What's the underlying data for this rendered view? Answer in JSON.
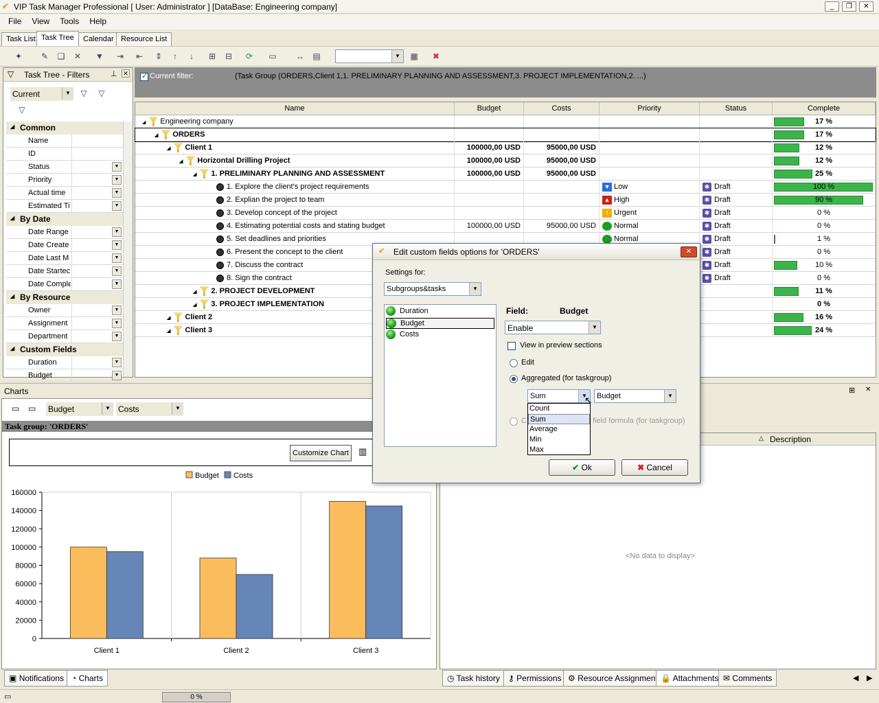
{
  "window": {
    "title": "VIP Task Manager Professional [ User: Administrator ] [DataBase: Engineering company]"
  },
  "menu": [
    "File",
    "View",
    "Tools",
    "Help"
  ],
  "tabs": [
    "Task List",
    "Task Tree",
    "Calendar",
    "Resource List"
  ],
  "filters_panel": {
    "title": "Task Tree - Filters",
    "current_value": "Current",
    "categories": [
      {
        "name": "Common",
        "items": [
          "Name",
          "ID",
          "Status",
          "Priority",
          "Actual time",
          "Estimated Ti"
        ]
      },
      {
        "name": "By Date",
        "items": [
          "Date Range",
          "Date Create",
          "Date Last M",
          "Date Startec",
          "Date Comple"
        ]
      },
      {
        "name": "By Resource",
        "items": [
          "Owner",
          "Assignment",
          "Department"
        ]
      },
      {
        "name": "Custom Fields",
        "items": [
          "Duration",
          "Budget"
        ]
      }
    ]
  },
  "filter_bar": {
    "label": "Current filter:",
    "text": "(Task Group  (ORDERS,Client 1,1. PRELIMINARY PLANNING AND ASSESSMENT,3. PROJECT IMPLEMENTATION,2. ...)"
  },
  "grid": {
    "columns": [
      "Name",
      "Budget",
      "Costs",
      "Priority",
      "Status",
      "Complete"
    ],
    "rows": [
      {
        "name": "Engineering company",
        "budget": "",
        "costs": "",
        "priority": "",
        "status": "",
        "complete": "17 %",
        "pct": 17,
        "bold": false
      },
      {
        "name": "ORDERS",
        "budget": "",
        "costs": "",
        "priority": "",
        "status": "",
        "complete": "17 %",
        "pct": 17,
        "bold": true
      },
      {
        "name": "Client 1",
        "budget": "100000,00 USD",
        "costs": "95000,00 USD",
        "priority": "",
        "status": "",
        "complete": "12 %",
        "pct": 12,
        "bold": true
      },
      {
        "name": "Horizontal Drilling Project",
        "budget": "100000,00 USD",
        "costs": "95000,00 USD",
        "priority": "",
        "status": "",
        "complete": "12 %",
        "pct": 12,
        "bold": true
      },
      {
        "name": "1. PRELIMINARY PLANNING AND ASSESSMENT",
        "budget": "100000,00 USD",
        "costs": "95000,00 USD",
        "priority": "",
        "status": "",
        "complete": "25 %",
        "pct": 25,
        "bold": true
      },
      {
        "name": "1. Explore the client's project requirements",
        "budget": "",
        "costs": "",
        "priority": "Low",
        "status": "Draft",
        "complete": "100 %",
        "pct": 100,
        "bold": false
      },
      {
        "name": "2. Explian the project to team",
        "budget": "",
        "costs": "",
        "priority": "High",
        "status": "Draft",
        "complete": "90 %",
        "pct": 90,
        "bold": false
      },
      {
        "name": "3. Develop concept of the project",
        "budget": "",
        "costs": "",
        "priority": "Urgent",
        "status": "Draft",
        "complete": "0 %",
        "pct": 0,
        "bold": false
      },
      {
        "name": "4. Estimating potential costs and stating budget",
        "budget": "100000,00 USD",
        "costs": "95000,00 USD",
        "priority": "Normal",
        "status": "Draft",
        "complete": "0 %",
        "pct": 0,
        "bold": false
      },
      {
        "name": "5. Set deadlines and priorities",
        "budget": "",
        "costs": "",
        "priority": "Normal",
        "status": "Draft",
        "complete": "1 %",
        "pct": 1,
        "bold": false
      },
      {
        "name": "6. Present the concept to the client",
        "budget": "",
        "costs": "",
        "priority": "",
        "status": "Draft",
        "complete": "0 %",
        "pct": 0,
        "bold": false
      },
      {
        "name": "7. Discuss the contract",
        "budget": "",
        "costs": "",
        "priority": "",
        "status": "Draft",
        "complete": "10 %",
        "pct": 10,
        "bold": false
      },
      {
        "name": "8. Sign the contract",
        "budget": "",
        "costs": "",
        "priority": "",
        "status": "Draft",
        "complete": "0 %",
        "pct": 0,
        "bold": false
      },
      {
        "name": "2. PROJECT DEVELOPMENT",
        "budget": "",
        "costs": "",
        "priority": "",
        "status": "",
        "complete": "11 %",
        "pct": 11,
        "bold": true
      },
      {
        "name": "3. PROJECT IMPLEMENTATION",
        "budget": "",
        "costs": "",
        "priority": "",
        "status": "",
        "complete": "0 %",
        "pct": 0,
        "bold": true
      },
      {
        "name": "Client 2",
        "budget": "",
        "costs": "",
        "priority": "",
        "status": "",
        "complete": "16 %",
        "pct": 16,
        "bold": true
      },
      {
        "name": "Client 3",
        "budget": "",
        "costs": "",
        "priority": "",
        "status": "",
        "complete": "24 %",
        "pct": 24,
        "bold": true
      }
    ]
  },
  "charts": {
    "panel_title": "Charts",
    "combo1": "Budget",
    "combo2": "Costs",
    "group_label": "Task group: 'ORDERS'",
    "customize_label": "Customize Chart"
  },
  "chart_data": {
    "type": "bar",
    "categories": [
      "Client 1",
      "Client 2",
      "Client 3"
    ],
    "series": [
      {
        "name": "Budget",
        "values": [
          100000,
          88000,
          150000
        ]
      },
      {
        "name": "Costs",
        "values": [
          95000,
          70000,
          145000
        ]
      }
    ],
    "ylim": [
      0,
      160000
    ],
    "yticks": [
      0,
      20000,
      40000,
      60000,
      80000,
      100000,
      120000,
      140000,
      160000
    ],
    "colors": [
      "#fbbd5c",
      "#6586b6"
    ],
    "legend": "top"
  },
  "right_panel": {
    "column": "Description",
    "empty": "<No data to display>"
  },
  "bottom_tabs_left": [
    "Notifications",
    "Charts"
  ],
  "bottom_tabs_right": [
    "Task history",
    "Permissions",
    "Resource Assignment",
    "Attachments",
    "Comments"
  ],
  "status": {
    "progress": "0 %"
  },
  "dialog": {
    "title": "Edit custom fields options for  'ORDERS'",
    "settings_label": "Settings for:",
    "settings_value": "Subgroups&tasks",
    "fields": [
      "Duration",
      "Budget",
      "Costs"
    ],
    "field_label": "Field:",
    "field_value": "Budget",
    "enable_value": "Enable",
    "view_preview": "View in preview sections",
    "edit_label": "Edit",
    "aggregated_label": "Aggregated (for taskgroup)",
    "agg_value": "Sum",
    "agg_field": "Budget",
    "formula_prefix": "C",
    "formula_suffix": "field formula (for taskgroup)",
    "agg_options": [
      "Count",
      "Sum",
      "Average",
      "Min",
      "Max"
    ],
    "ok": "Ok",
    "cancel": "Cancel"
  }
}
